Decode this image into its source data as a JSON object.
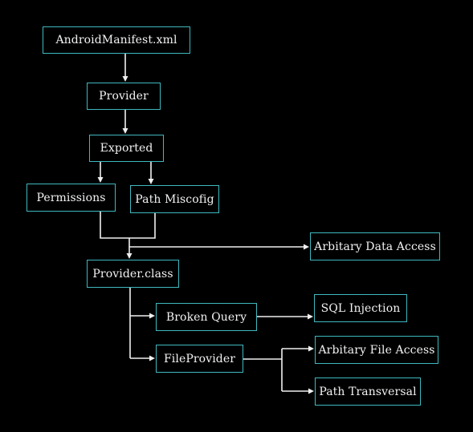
{
  "diagram": {
    "title": "",
    "colors": {
      "background": "#000000",
      "node_border": "#3fb8bf",
      "text": "#f2f2f2",
      "edge": "#f0f0f0"
    },
    "nodes": {
      "manifest": "AndroidManifest.xml",
      "provider": "Provider",
      "exported": "Exported",
      "permissions": "Permissions",
      "path_misconfig": "Path Miscofig",
      "arbitrary_data_access": "Arbitary Data Access",
      "provider_class": "Provider.class",
      "broken_query": "Broken Query",
      "sql_injection": "SQL Injection",
      "file_provider": "FileProvider",
      "arbitrary_file_access": "Arbitary File Access",
      "path_traversal": "Path Transversal"
    },
    "edges": [
      {
        "from": "AndroidManifest.xml",
        "to": "Provider"
      },
      {
        "from": "Provider",
        "to": "Exported"
      },
      {
        "from": "Exported",
        "to": "Permissions"
      },
      {
        "from": "Exported",
        "to": "Path Miscofig"
      },
      {
        "from": "Permissions",
        "to": "Provider.class"
      },
      {
        "from": "Path Miscofig",
        "to": "Provider.class"
      },
      {
        "from": "Permissions + Path Miscofig",
        "to": "Arbitary Data Access"
      },
      {
        "from": "Provider.class",
        "to": "Broken Query"
      },
      {
        "from": "Provider.class",
        "to": "FileProvider"
      },
      {
        "from": "Broken Query",
        "to": "SQL Injection"
      },
      {
        "from": "FileProvider",
        "to": "Arbitary File Access"
      },
      {
        "from": "FileProvider",
        "to": "Path Transversal"
      }
    ]
  }
}
